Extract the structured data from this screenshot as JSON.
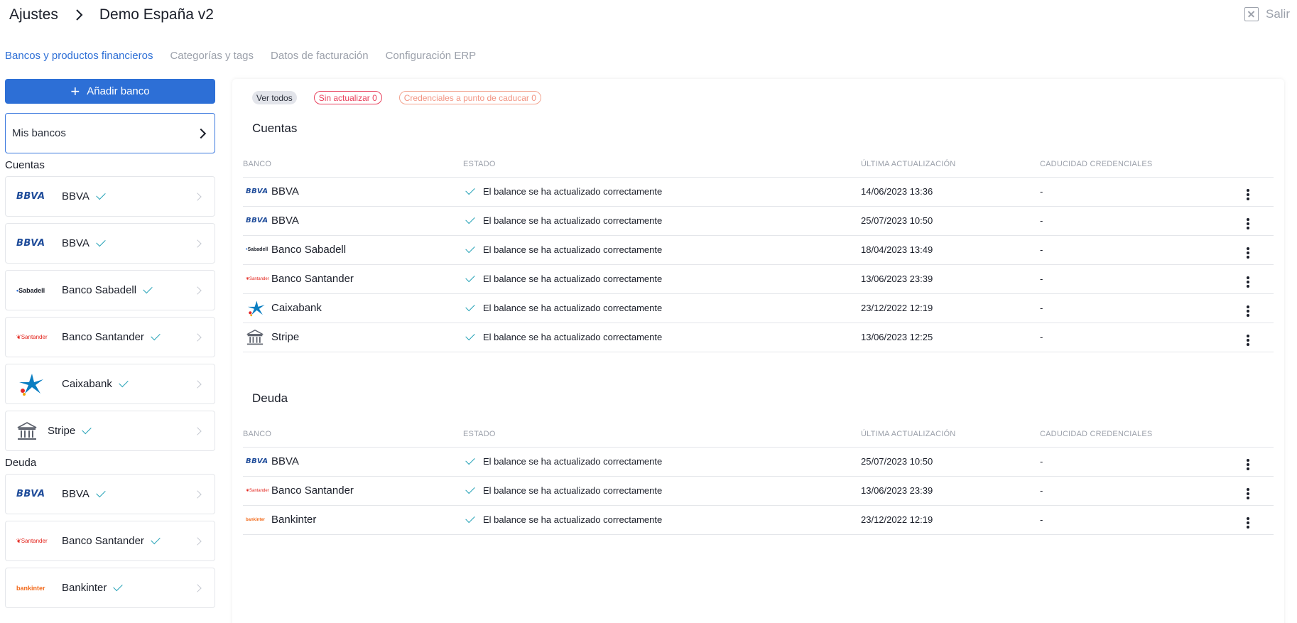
{
  "header": {
    "crumb_root": "Ajustes",
    "crumb_current": "Demo España v2",
    "exit_label": "Salir"
  },
  "tabs": [
    {
      "label": "Bancos y productos financieros",
      "active": true
    },
    {
      "label": "Categorías y tags",
      "active": false
    },
    {
      "label": "Datos de facturación",
      "active": false
    },
    {
      "label": "Configuración ERP",
      "active": false
    }
  ],
  "sidebar": {
    "add_bank_label": "Añadir banco",
    "my_banks_label": "Mis bancos",
    "accounts_label": "Cuentas",
    "debt_label": "Deuda",
    "accounts": [
      {
        "name": "BBVA",
        "logo": "BBVA"
      },
      {
        "name": "BBVA",
        "logo": "BBVA"
      },
      {
        "name": "Banco Sabadell",
        "logo": "Sabadell"
      },
      {
        "name": "Banco Santander",
        "logo": "Santander"
      },
      {
        "name": "Caixabank",
        "logo": "caixabank-star-icon"
      },
      {
        "name": "Stripe",
        "logo": "bank-building-icon"
      }
    ],
    "debt": [
      {
        "name": "BBVA",
        "logo": "BBVA"
      },
      {
        "name": "Banco Santander",
        "logo": "Santander"
      },
      {
        "name": "Bankinter",
        "logo": "bankinter"
      }
    ]
  },
  "filters": {
    "all": "Ver todos",
    "not_updated": "Sin actualizar 0",
    "expiring": "Credenciales a punto de caducar 0"
  },
  "columns": {
    "bank": "BANCO",
    "status": "ESTADO",
    "last_update": "ÚLTIMA ACTUALIZACIÓN",
    "credentials": "CADUCIDAD CREDENCIALES"
  },
  "accounts_section": {
    "title": "Cuentas",
    "rows": [
      {
        "bank": "BBVA",
        "logo": "BBVA",
        "status": "El balance se ha actualizado correctamente",
        "updated": "14/06/2023 13:36",
        "credentials": "-"
      },
      {
        "bank": "BBVA",
        "logo": "BBVA",
        "status": "El balance se ha actualizado correctamente",
        "updated": "25/07/2023 10:50",
        "credentials": "-"
      },
      {
        "bank": "Banco Sabadell",
        "logo": "Sabadell",
        "status": "El balance se ha actualizado correctamente",
        "updated": "18/04/2023 13:49",
        "credentials": "-"
      },
      {
        "bank": "Banco Santander",
        "logo": "Santander",
        "status": "El balance se ha actualizado correctamente",
        "updated": "13/06/2023 23:39",
        "credentials": "-"
      },
      {
        "bank": "Caixabank",
        "logo": "caixabank-star-icon",
        "status": "El balance se ha actualizado correctamente",
        "updated": "23/12/2022 12:19",
        "credentials": "-"
      },
      {
        "bank": "Stripe",
        "logo": "bank-building-icon",
        "status": "El balance se ha actualizado correctamente",
        "updated": "13/06/2023 12:25",
        "credentials": "-"
      }
    ]
  },
  "debt_section": {
    "title": "Deuda",
    "rows": [
      {
        "bank": "BBVA",
        "logo": "BBVA",
        "status": "El balance se ha actualizado correctamente",
        "updated": "25/07/2023 10:50",
        "credentials": "-"
      },
      {
        "bank": "Banco Santander",
        "logo": "Santander",
        "status": "El balance se ha actualizado correctamente",
        "updated": "13/06/2023 23:39",
        "credentials": "-"
      },
      {
        "bank": "Bankinter",
        "logo": "bankinter",
        "status": "El balance se ha actualizado correctamente",
        "updated": "23/12/2022 12:19",
        "credentials": "-"
      }
    ]
  },
  "colors": {
    "accent": "#2d6fd6",
    "check": "#28a3b8",
    "danger": "#e8405c",
    "warning": "#f29583"
  }
}
